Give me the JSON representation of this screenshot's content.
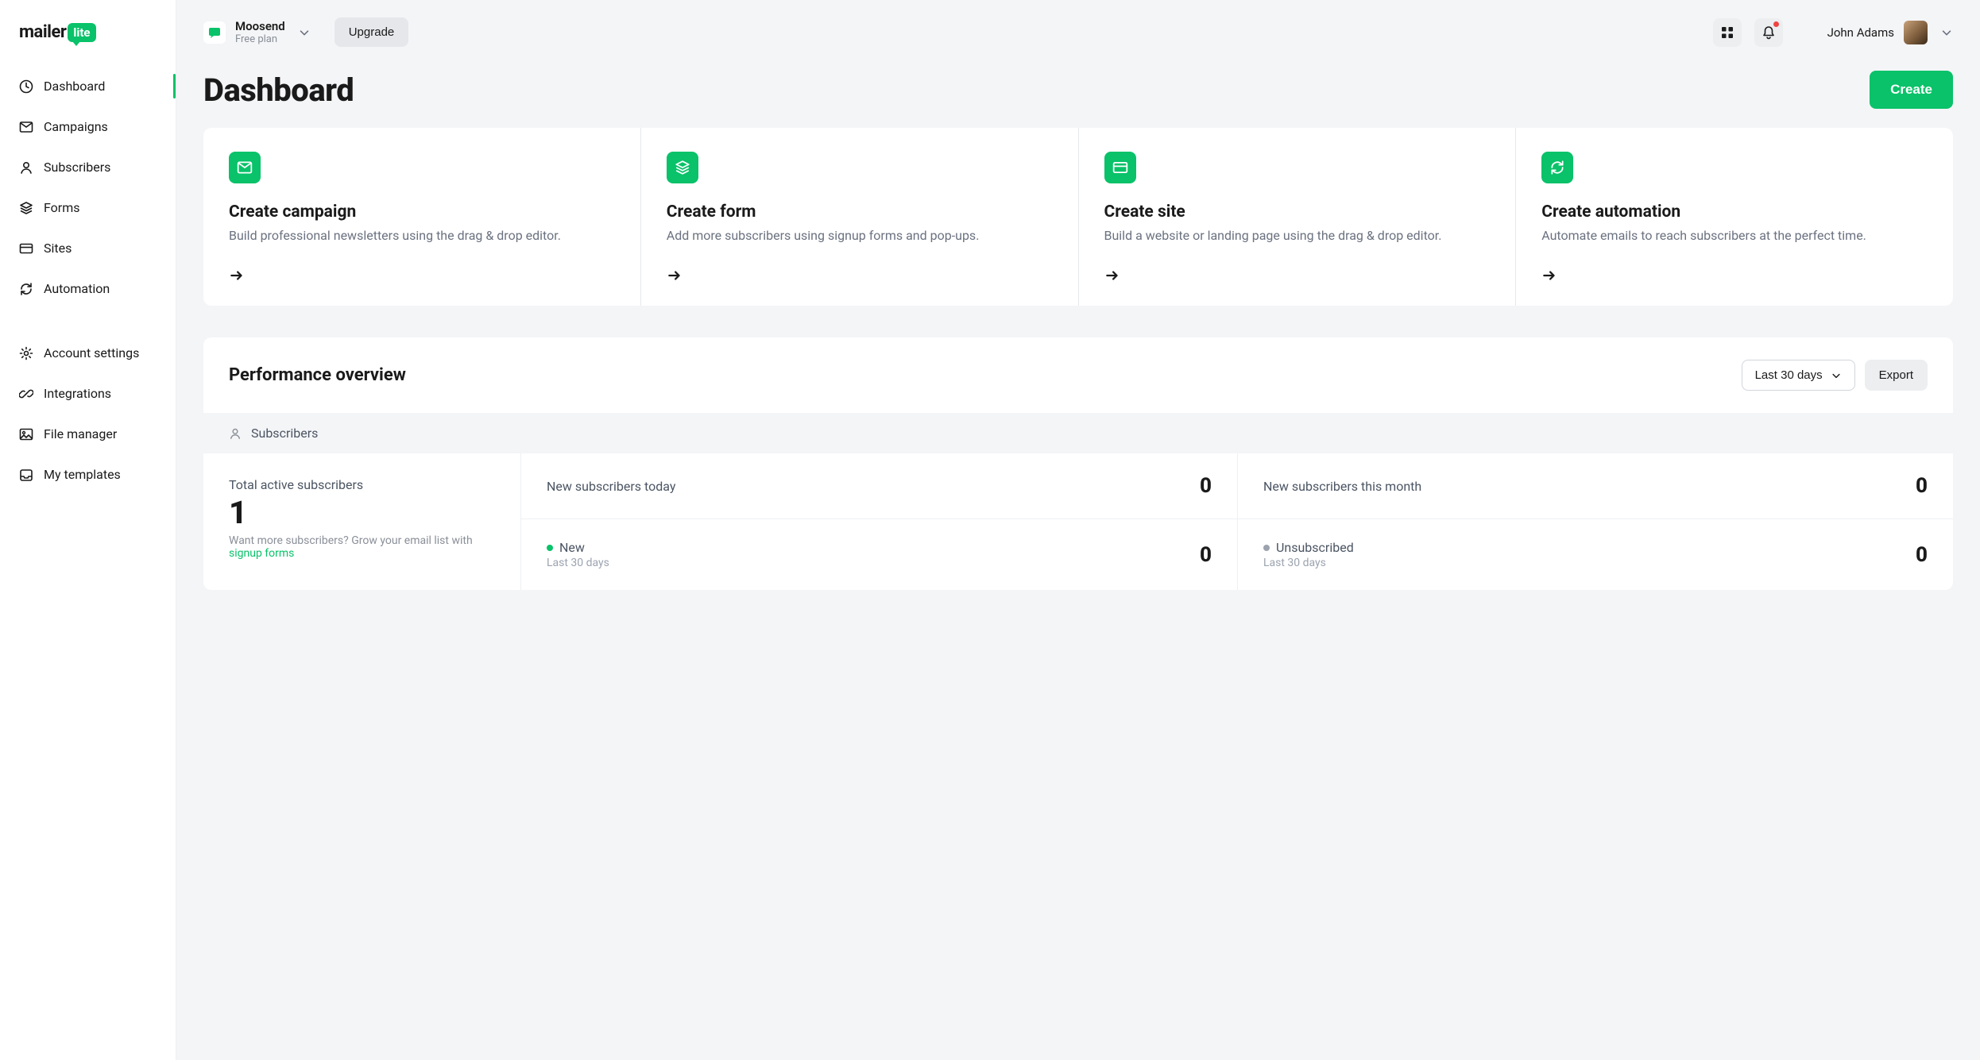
{
  "brand": {
    "prefix": "mailer",
    "suffix": "lite"
  },
  "nav": {
    "primary": [
      {
        "label": "Dashboard",
        "name": "sidebar-item-dashboard",
        "icon": "clock-icon",
        "active": true
      },
      {
        "label": "Campaigns",
        "name": "sidebar-item-campaigns",
        "icon": "mail-icon"
      },
      {
        "label": "Subscribers",
        "name": "sidebar-item-subscribers",
        "icon": "user-icon"
      },
      {
        "label": "Forms",
        "name": "sidebar-item-forms",
        "icon": "layers-icon"
      },
      {
        "label": "Sites",
        "name": "sidebar-item-sites",
        "icon": "card-icon"
      },
      {
        "label": "Automation",
        "name": "sidebar-item-automation",
        "icon": "refresh-icon"
      }
    ],
    "secondary": [
      {
        "label": "Account settings",
        "name": "sidebar-item-account-settings",
        "icon": "gear-icon"
      },
      {
        "label": "Integrations",
        "name": "sidebar-item-integrations",
        "icon": "link-icon"
      },
      {
        "label": "File manager",
        "name": "sidebar-item-file-manager",
        "icon": "image-icon"
      },
      {
        "label": "My templates",
        "name": "sidebar-item-my-templates",
        "icon": "tray-icon"
      }
    ]
  },
  "header": {
    "account_name": "Moosend",
    "plan": "Free plan",
    "upgrade_label": "Upgrade",
    "user_name": "John Adams"
  },
  "page": {
    "title": "Dashboard",
    "create_label": "Create"
  },
  "quick_cards": [
    {
      "title": "Create campaign",
      "desc": "Build professional newsletters using the drag & drop editor.",
      "icon": "mail-icon",
      "name": "quick-create-campaign"
    },
    {
      "title": "Create form",
      "desc": "Add more subscribers using signup forms and pop-ups.",
      "icon": "layers-icon",
      "name": "quick-create-form"
    },
    {
      "title": "Create site",
      "desc": "Build a website or landing page using the drag & drop editor.",
      "icon": "card-icon",
      "name": "quick-create-site"
    },
    {
      "title": "Create automation",
      "desc": "Automate emails to reach subscribers at the perfect time.",
      "icon": "refresh-icon",
      "name": "quick-create-automation"
    }
  ],
  "performance": {
    "title": "Performance overview",
    "range_label": "Last 30 days",
    "export_label": "Export",
    "subs_label": "Subscribers",
    "total": {
      "label": "Total active subscribers",
      "value": "1",
      "hint_prefix": "Want more subscribers? ",
      "hint_gray": "Grow your email list with ",
      "hint_link": "signup forms"
    },
    "cells": {
      "today": {
        "label": "New subscribers today",
        "value": "0"
      },
      "month": {
        "label": "New subscribers this month",
        "value": "0"
      },
      "new": {
        "label": "New",
        "sub": "Last 30 days",
        "value": "0",
        "dot": "green"
      },
      "unsub": {
        "label": "Unsubscribed",
        "sub": "Last 30 days",
        "value": "0",
        "dot": "gray"
      }
    }
  }
}
